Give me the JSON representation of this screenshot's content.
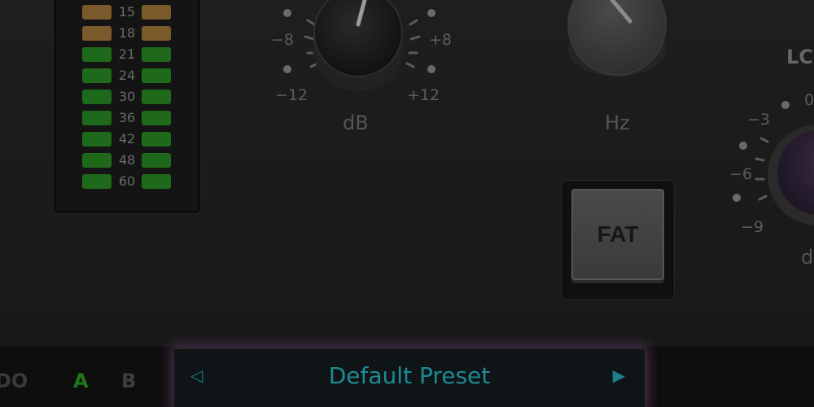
{
  "meter": {
    "labels": [
      "15",
      "18",
      "21",
      "24",
      "30",
      "36",
      "42",
      "48",
      "60"
    ],
    "colors": {
      "amber": "#7a5a2a",
      "green": "#1f6a1a"
    }
  },
  "gain_knob": {
    "scale_left_top": "−8",
    "scale_right_top": "+8",
    "scale_left_bottom": "−12",
    "scale_right_bottom": "+12",
    "unit": "dB"
  },
  "freq_knob": {
    "unit": "Hz"
  },
  "right_section": {
    "title": "LC",
    "scale": [
      "−3",
      "−6",
      "−9",
      "0"
    ],
    "unit": "d"
  },
  "fat_button": {
    "label": "FAT"
  },
  "bottom_bar": {
    "left_label": "DO",
    "a_label": "A",
    "b_label": "B",
    "preset_name": "Default Preset",
    "prev_arrow": "◁",
    "next_arrow": "▶"
  },
  "colors": {
    "accent_teal": "#1e8a93",
    "preset_glow": "#965aa0",
    "a_active": "#1f7a1c"
  }
}
